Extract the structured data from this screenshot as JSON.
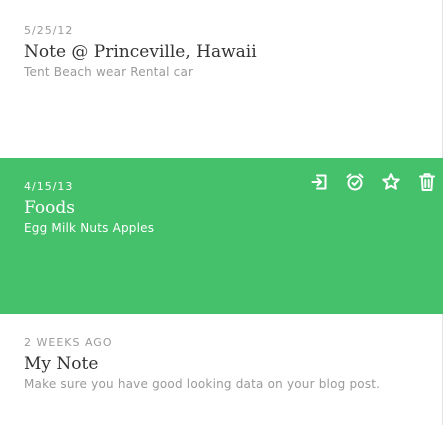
{
  "notes": [
    {
      "date": "5/25/12",
      "title": "Note @ Princeville, Hawaii",
      "snippet": "Tent Beach wear Rental car",
      "selected": false
    },
    {
      "date": "4/15/13",
      "title": "Foods",
      "snippet": "Egg Milk Nuts Apples",
      "selected": true
    },
    {
      "date": "2 WEEKS AGO",
      "title": "My Note",
      "snippet": "Make sure you have good looking data on your blog post.",
      "selected": false
    }
  ],
  "selected_note_actions": [
    {
      "icon": "share-icon"
    },
    {
      "icon": "reminder-icon"
    },
    {
      "icon": "star-icon"
    },
    {
      "icon": "trash-icon"
    }
  ],
  "colors": {
    "selected_background": "#45c06b",
    "date_text": "#9a9a9a",
    "title_text": "#333333",
    "snippet_text": "#9a9a9a"
  }
}
